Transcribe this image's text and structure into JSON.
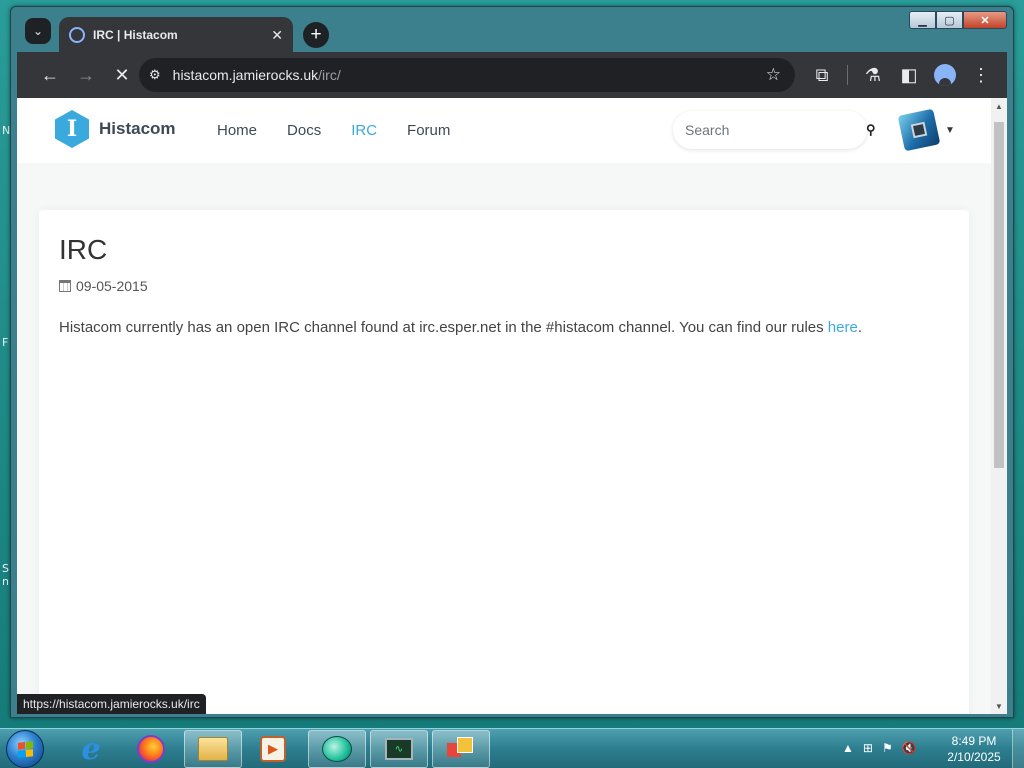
{
  "browser": {
    "tab_title": "IRC | Histacom",
    "tab_close": "✕",
    "new_tab": "+",
    "url_host": "histacom.jamierocks.uk",
    "url_path": "/irc/",
    "status_url": "https://histacom.jamierocks.uk/irc",
    "caption": {
      "minimize": "▁",
      "maximize": "▢",
      "close": "✕"
    }
  },
  "site": {
    "logo_letter": "I",
    "logo_text": "Histacom",
    "nav": [
      "Home",
      "Docs",
      "IRC",
      "Forum"
    ],
    "active_nav": "IRC",
    "search_placeholder": "Search",
    "accent_color": "#3aa9de"
  },
  "article": {
    "title": "IRC",
    "date": "09-05-2015",
    "body_before_link": "Histacom currently has an open IRC channel found at irc.esper.net in the #histacom channel. You can find our rules ",
    "link_text": "here",
    "body_after_link": "."
  },
  "desktop": {
    "edge_chars": [
      "N",
      "F",
      "S",
      "n"
    ]
  },
  "taskbar": {
    "apps": [
      "internet-explorer",
      "firefox",
      "file-explorer",
      "media-player",
      "chat-app",
      "system-monitor",
      "control-panel"
    ],
    "clock_time": "8:49 PM",
    "clock_date": "2/10/2025"
  }
}
